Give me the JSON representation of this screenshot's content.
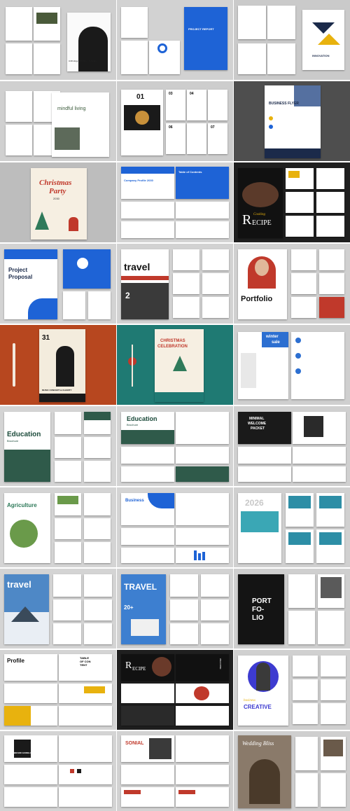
{
  "tiles": {
    "t1": {
      "title": "",
      "caption": "Anthology. Brochure. Template"
    },
    "t2": {
      "title": "PROJECT REPORT"
    },
    "t3": {
      "title": "INNOVATION"
    },
    "t4": {
      "title": "mindful living"
    },
    "t5": {
      "month_a": "01",
      "month_b": "JANUARY",
      "m03": "03",
      "m04": "04",
      "m06": "06",
      "m07": "07"
    },
    "t6": {
      "title": "BUSINESS FLYER"
    },
    "t7": {
      "title_a": "Christmas",
      "title_b": "Party",
      "year": "2030"
    },
    "t8": {
      "title": "Company Profile 2030",
      "toc": "Table of Contents"
    },
    "t9": {
      "title_a": "R",
      "title_b": "ECIPE",
      "script": "Cooking"
    },
    "t10": {
      "title_a": "Project",
      "title_b": "Proposal"
    },
    "t11": {
      "title": "travel",
      "num": "2"
    },
    "t12": {
      "title": "Portfolio"
    },
    "t13": {
      "num": "31",
      "caption": "MUSIC CONCERT & CHARITY"
    },
    "t14": {
      "title_a": "CHRISTMAS",
      "title_b": "CELEBRATION"
    },
    "t15": {
      "title_a": "winter",
      "title_b": "sale"
    },
    "t16": {
      "title": "Education",
      "sub": "Brochure"
    },
    "t17": {
      "title": "Education",
      "sub": "Brochure"
    },
    "t18": {
      "title_a": "MINIMAL",
      "title_b": "WELCOME",
      "title_c": "PACKET"
    },
    "t19": {
      "title": "Agriculture"
    },
    "t20": {
      "title": "Business"
    },
    "t21": {
      "year": "2026"
    },
    "t22": {
      "title": "travel"
    },
    "t23": {
      "title": "TRAVEL",
      "num": "20+"
    },
    "t24": {
      "title_a": "PORT",
      "title_b": "FO-",
      "title_c": "LIO"
    },
    "t25": {
      "title": "Profile",
      "toc_a": "TABLE",
      "toc_b": "OF CON",
      "toc_c": "TENT"
    },
    "t26": {
      "title_a": "R",
      "title_b": "ECIPE",
      "side": "WELCOME"
    },
    "t27": {
      "title": "CREATIVE",
      "script": "business"
    },
    "t28": {
      "title": "BRAND GUIDELINE"
    },
    "t29": {
      "title": "SONIAL"
    },
    "t30": {
      "title": "Wedding Bliss"
    }
  },
  "colors": {
    "blue": "#1e63d6",
    "navy": "#1b2a4a",
    "gold": "#e8b20e",
    "red": "#c0392b",
    "teal": "#1f7a73",
    "green": "#2f7a5a",
    "orange": "#b7471f",
    "gray": "#d4d4d4"
  }
}
